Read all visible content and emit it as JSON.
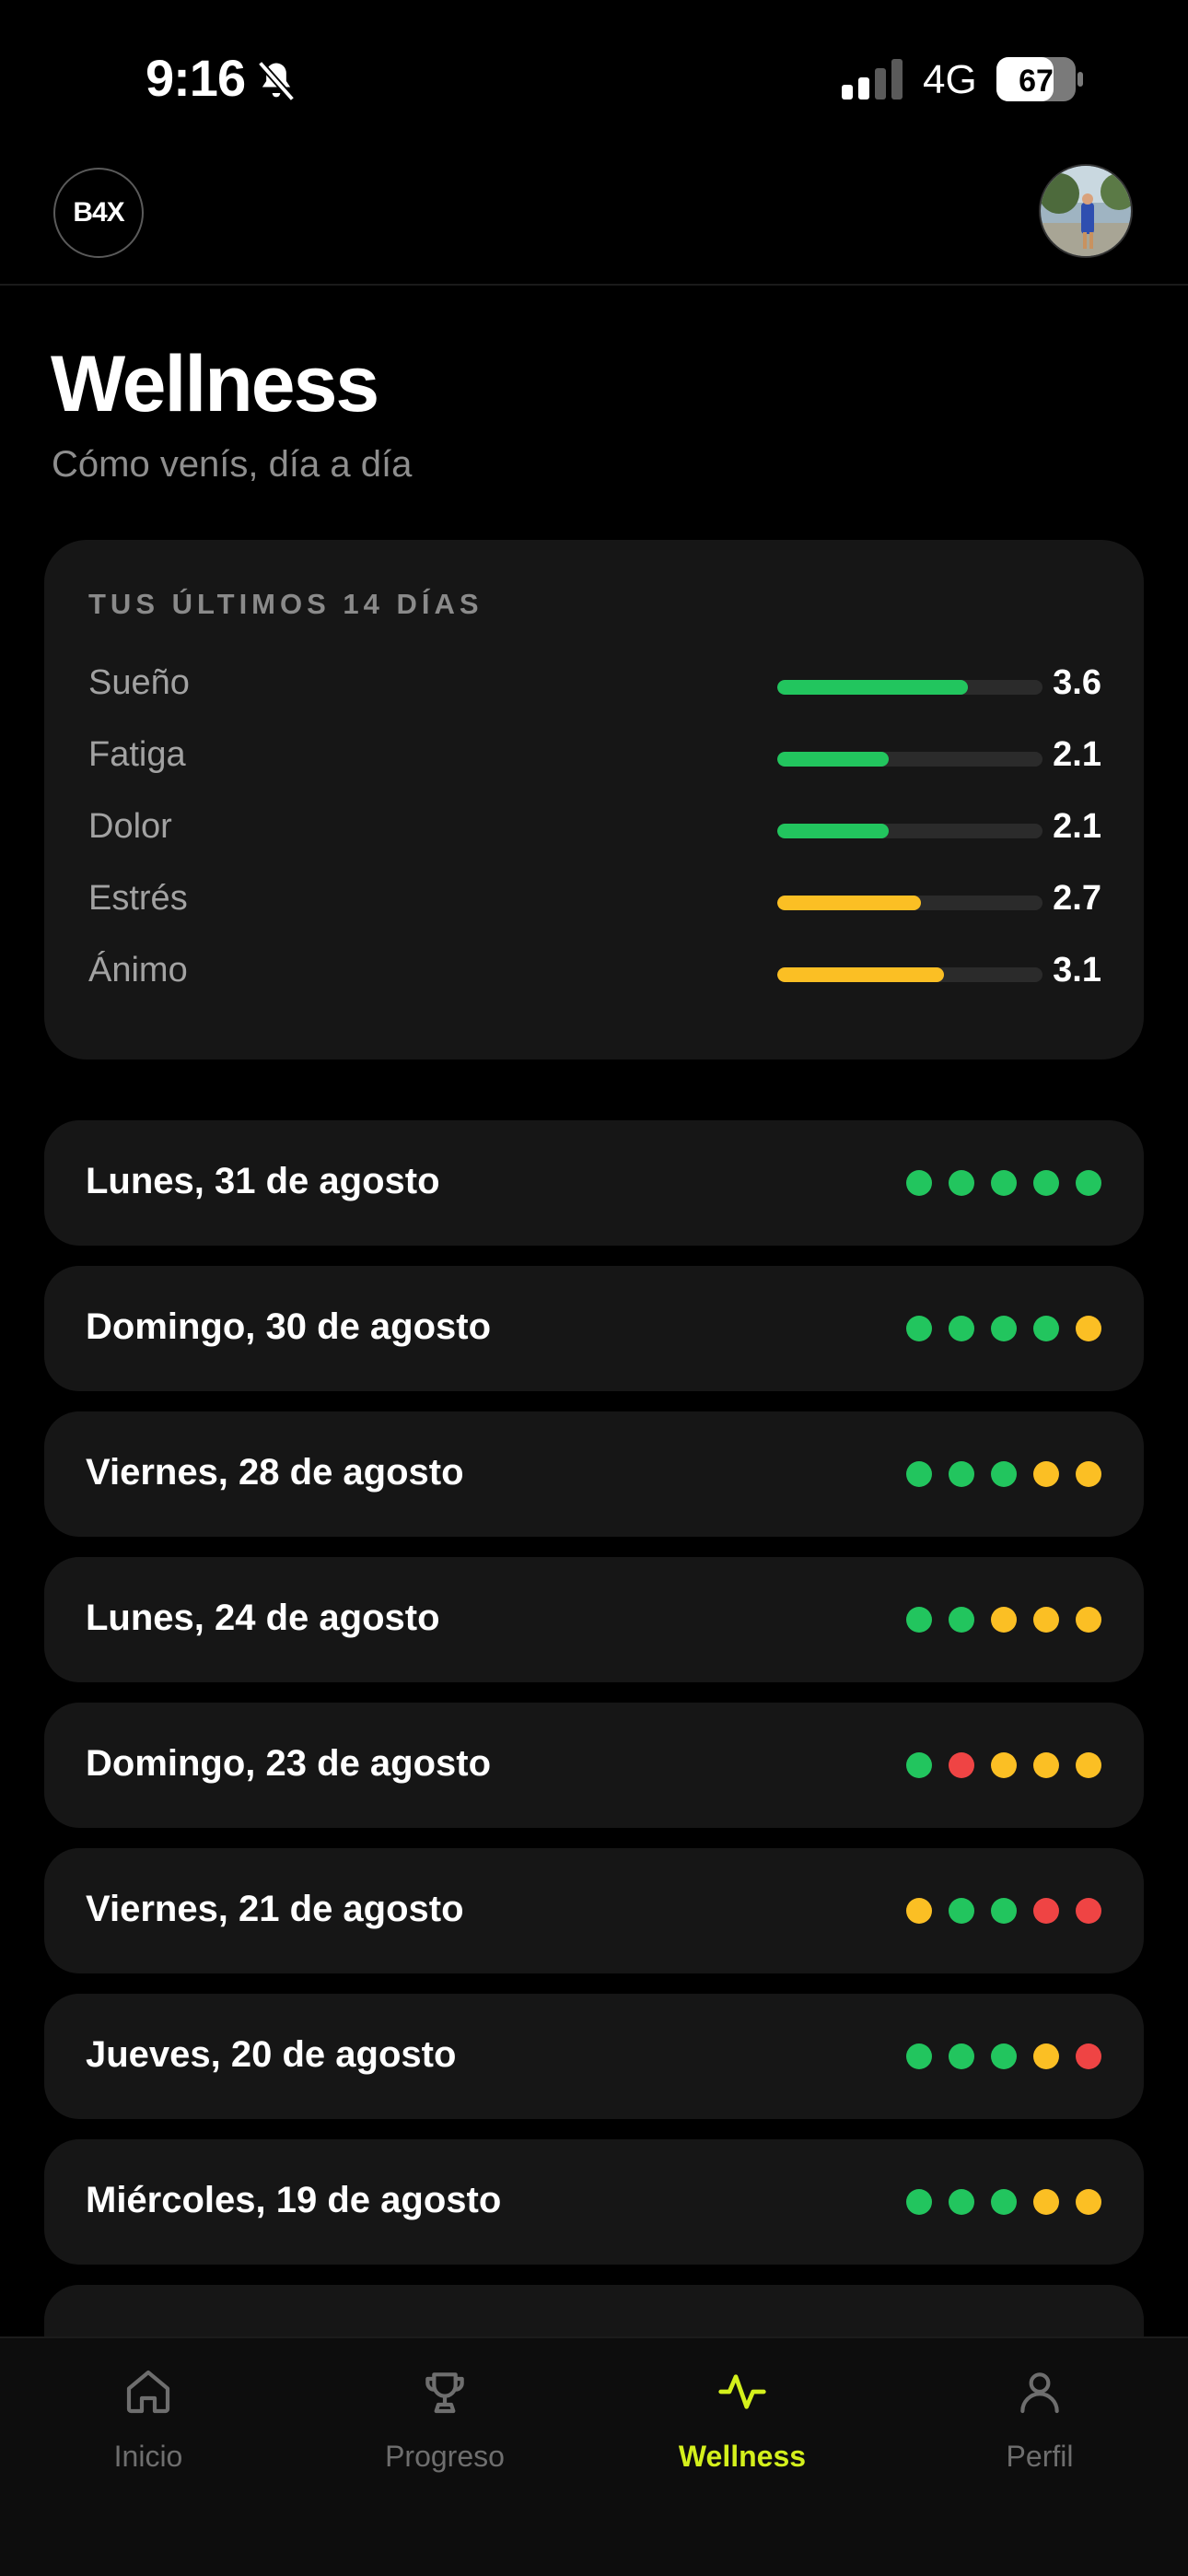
{
  "status_bar": {
    "time": "9:16",
    "network": "4G",
    "battery": "67"
  },
  "header": {
    "logo_text": "B4X"
  },
  "page": {
    "title": "Wellness",
    "subtitle": "Cómo venís, día a día"
  },
  "summary": {
    "heading": "TUS ÚLTIMOS 14 DÍAS",
    "metrics": [
      {
        "label": "Sueño",
        "value": "3.6",
        "level": 0.72,
        "color": "#22c55e"
      },
      {
        "label": "Fatiga",
        "value": "2.1",
        "level": 0.42,
        "color": "#22c55e"
      },
      {
        "label": "Dolor",
        "value": "2.1",
        "level": 0.42,
        "color": "#22c55e"
      },
      {
        "label": "Estrés",
        "value": "2.7",
        "level": 0.54,
        "color": "#fbbf24"
      },
      {
        "label": "Ánimo",
        "value": "3.1",
        "level": 0.63,
        "color": "#fbbf24"
      }
    ]
  },
  "days": [
    {
      "label": "Lunes, 31 de agosto",
      "dots": [
        "green",
        "green",
        "green",
        "green",
        "green"
      ]
    },
    {
      "label": "Domingo, 30 de agosto",
      "dots": [
        "green",
        "green",
        "green",
        "green",
        "yellow"
      ]
    },
    {
      "label": "Viernes, 28 de agosto",
      "dots": [
        "green",
        "green",
        "green",
        "yellow",
        "yellow"
      ]
    },
    {
      "label": "Lunes, 24 de agosto",
      "dots": [
        "green",
        "green",
        "yellow",
        "yellow",
        "yellow"
      ]
    },
    {
      "label": "Domingo, 23 de agosto",
      "dots": [
        "green",
        "red",
        "yellow",
        "yellow",
        "yellow"
      ]
    },
    {
      "label": "Viernes, 21 de agosto",
      "dots": [
        "yellow",
        "green",
        "green",
        "red",
        "red"
      ]
    },
    {
      "label": "Jueves, 20 de agosto",
      "dots": [
        "green",
        "green",
        "green",
        "yellow",
        "red"
      ]
    },
    {
      "label": "Miércoles, 19 de agosto",
      "dots": [
        "green",
        "green",
        "green",
        "yellow",
        "yellow"
      ]
    }
  ],
  "colors": {
    "green": "#22c55e",
    "yellow": "#fbbf24",
    "red": "#ef4444",
    "accent": "#d4f01c"
  },
  "tabs": [
    {
      "label": "Inicio",
      "icon": "home-icon",
      "active": false
    },
    {
      "label": "Progreso",
      "icon": "trophy-icon",
      "active": false
    },
    {
      "label": "Wellness",
      "icon": "activity-icon",
      "active": true
    },
    {
      "label": "Perfil",
      "icon": "user-icon",
      "active": false
    }
  ]
}
